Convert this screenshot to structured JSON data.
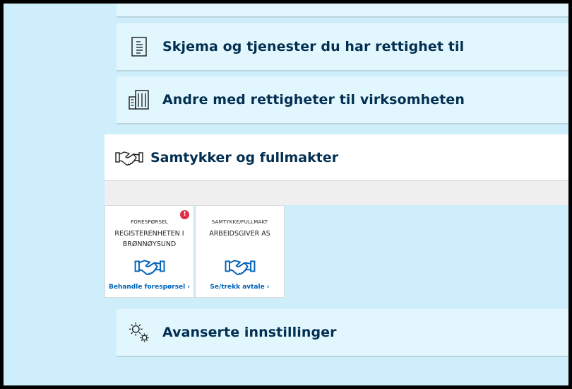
{
  "sections": {
    "forms_label": "Skjema og tjenester du har rettighet til",
    "others_label": "Andre med rettigheter til virksomheten",
    "consents_label": "Samtykker og fullmakter",
    "advanced_label": "Avanserte innstillinger"
  },
  "cards": [
    {
      "kind": "FORESPØRSEL",
      "org": "REGISTERENHETEN I BRØNNØYSUND",
      "link": "Behandle forespørsel ›",
      "badge": "!"
    },
    {
      "kind": "SAMTYKKE/FULLMAKT",
      "org": "ARBEIDSGIVER AS",
      "link": "Se/trekk avtale ›"
    }
  ],
  "colors": {
    "page_background": "#cfeefc",
    "section_background": "#e1f6fd",
    "text_dark": "#022f51",
    "link_blue": "#0062ba",
    "badge_red": "#e02e49"
  },
  "icons": {
    "forms": "document-list-icon",
    "others": "buildings-icon",
    "consents": "handshake-icon",
    "advanced": "gears-icon"
  }
}
